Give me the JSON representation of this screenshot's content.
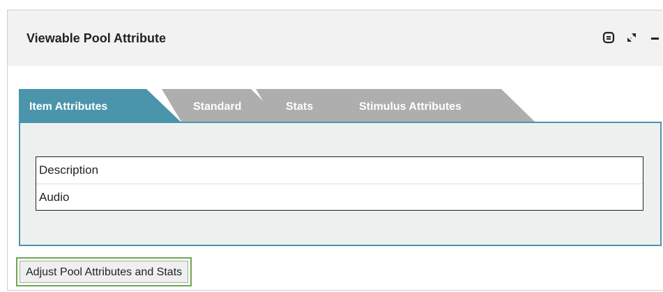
{
  "panel": {
    "title": "Viewable Pool Attribute",
    "header_icons": [
      "restore-window-icon",
      "expand-icon",
      "minimize-icon"
    ]
  },
  "tabs": [
    {
      "label": "Item Attributes",
      "active": true
    },
    {
      "label": "Standard",
      "active": false
    },
    {
      "label": "Stats",
      "active": false
    },
    {
      "label": "Stimulus Attributes",
      "active": false
    }
  ],
  "attributes": {
    "items": [
      "Description",
      "Audio"
    ]
  },
  "actions": {
    "adjust_label": "Adjust Pool Attributes and Stats"
  },
  "colors": {
    "active_tab": "#4a95ab",
    "inactive_tab": "#aeaeae",
    "button_highlight": "#6aa84f"
  }
}
